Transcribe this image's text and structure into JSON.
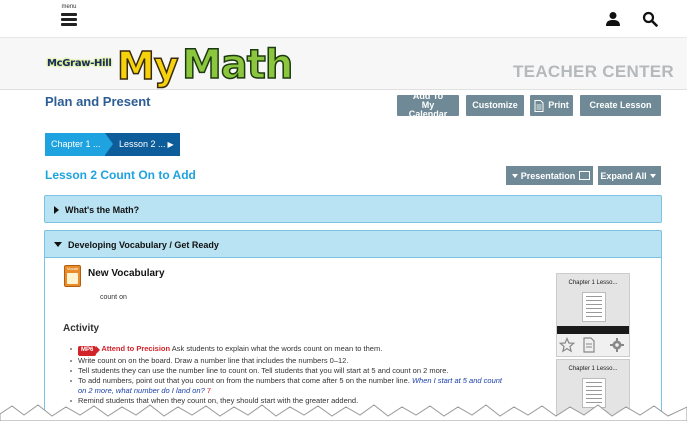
{
  "topbar": {
    "menu_label": "menu",
    "icons": [
      "user-icon",
      "search-icon"
    ]
  },
  "brand": {
    "logo_publisher": "McGraw-Hill",
    "logo_my": "My",
    "logo_math": "Math",
    "section": "TEACHER CENTER"
  },
  "plan": {
    "title": "Plan and Present",
    "buttons": {
      "add_calendar": "Add To My Calendar",
      "customize": "Customize",
      "print": "Print",
      "create_lesson": "Create Lesson"
    }
  },
  "breadcrumb": {
    "chapter": "Chapter 1 ...",
    "lesson": "Lesson 2 ..."
  },
  "lesson": {
    "title": "Lesson 2 Count On to Add",
    "presentation": "Presentation",
    "expand_all": "Expand All"
  },
  "sections": {
    "whats_math": "What's the Math?",
    "vocab": "Developing Vocabulary / Get Ready"
  },
  "content": {
    "vocab_icon_label": "Vocab",
    "new_vocab": "New Vocabulary",
    "vocab_word": "count on",
    "activity": "Activity",
    "items": {
      "mp_badge": "MP6",
      "attend": "Attend to Precision",
      "i1_rest": " Ask students to explain what the words count on mean to them.",
      "i2": "Write count on on the board. Draw a number line that includes the numbers 0–12.",
      "i3": "Tell students they can use the number line to count on. Tell students that you will start at 5 and count on 2 more.",
      "i4_a": "To add numbers, point out that you count on from the numbers that come after 5 on the number line. ",
      "i4_b": "When I start at 5 and count on 2 more, what number do I land on?",
      "i4_c": " 7",
      "i5": "Remind students that when they count on, they should start with the greater addend."
    }
  },
  "thumbs": [
    {
      "caption": "Chapter 1 Lesso..."
    },
    {
      "caption": "Chapter 1 Lesso..."
    }
  ],
  "colors": {
    "title_blue": "#2c5d94",
    "accent_cyan": "#1ea3e0",
    "button_gray": "#6f8a96",
    "accordion": "#b9e3f3",
    "mp_red": "#d2232a"
  }
}
